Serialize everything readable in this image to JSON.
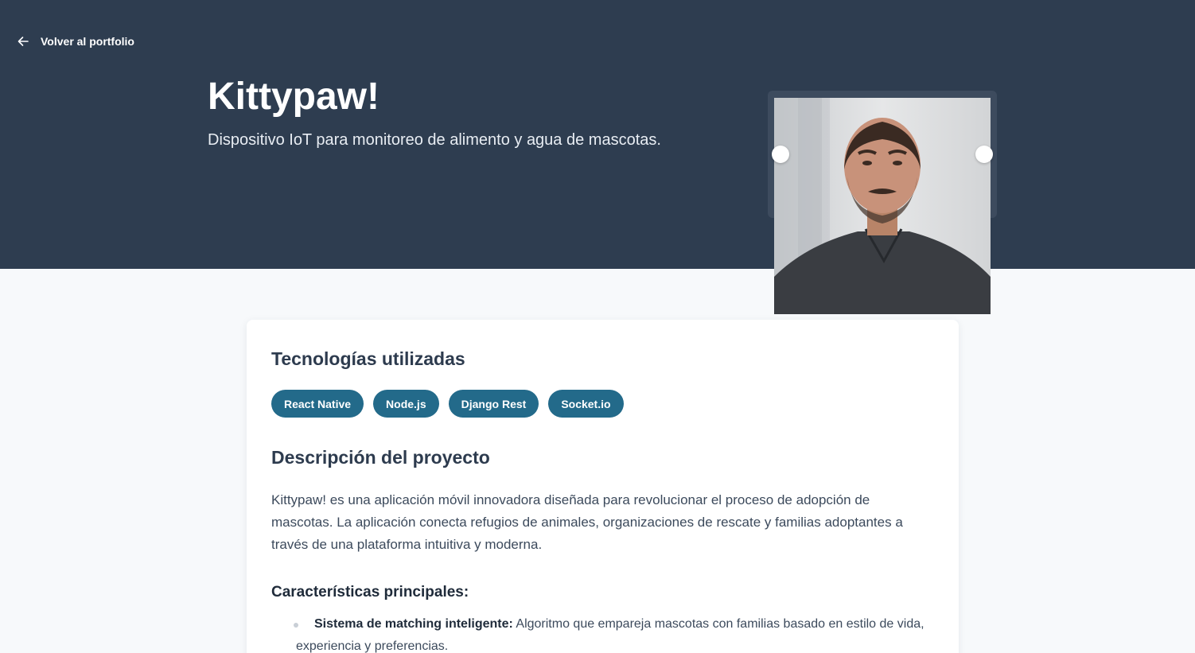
{
  "nav": {
    "back_label": "Volver al portfolio"
  },
  "hero": {
    "title": "Kittypaw!",
    "subtitle": "Dispositivo IoT para monitoreo de alimento y agua de mascotas."
  },
  "technologies": {
    "title": "Tecnologías utilizadas",
    "tags": [
      "React Native",
      "Node.js",
      "Django Rest",
      "Socket.io"
    ]
  },
  "description": {
    "title": "Descripción del proyecto",
    "text": "Kittypaw! es una aplicación móvil innovadora diseñada para revolucionar el proceso de adopción de mascotas. La aplicación conecta refugios de animales, organizaciones de rescate y familias adoptantes a través de una plataforma intuitiva y moderna."
  },
  "features": {
    "title": "Características principales:",
    "items": [
      {
        "label": "Sistema de matching inteligente:",
        "text": " Algoritmo que empareja mascotas con familias basado en estilo de vida, experiencia y preferencias."
      }
    ]
  },
  "colors": {
    "hero_bg": "#2e3d50",
    "tag_bg": "#236a8a",
    "page_bg": "#f7f9fb"
  },
  "icons": {
    "back": "arrow-left-icon"
  }
}
